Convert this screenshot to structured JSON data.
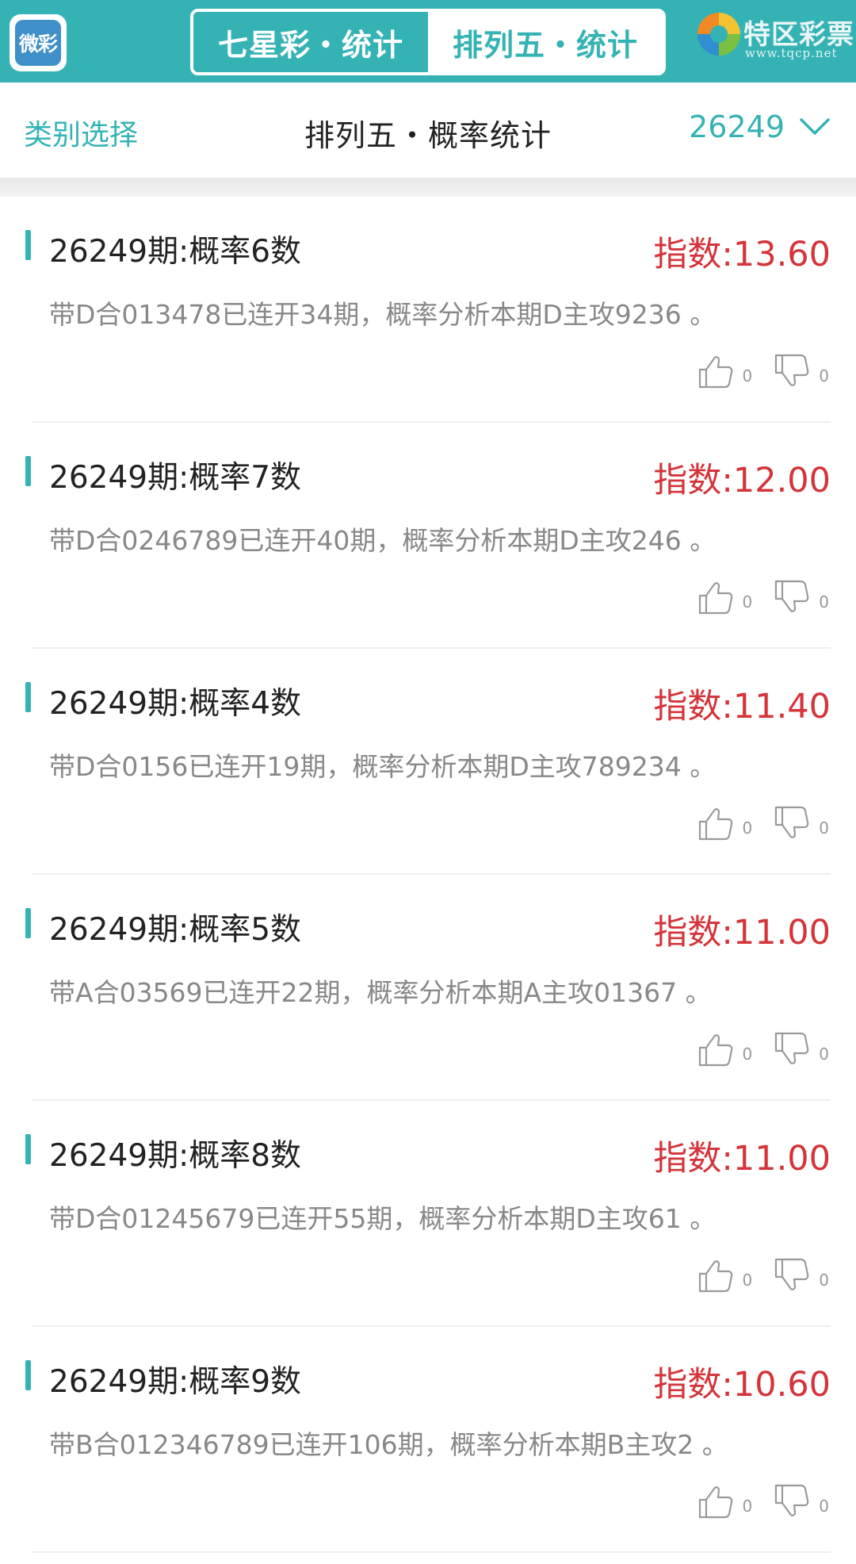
{
  "header": {
    "app_logo_text": "微彩",
    "tabs": [
      {
        "label": "七星彩・统计",
        "active": false
      },
      {
        "label": "排列五・统计",
        "active": true
      }
    ],
    "brand_name": "特区彩票网",
    "brand_url": "www.tqcp.net"
  },
  "subheader": {
    "category_label": "类别选择",
    "title": "排列五・概率统计",
    "period": "26249"
  },
  "colors": {
    "accent": "#35b3b4",
    "index_red": "#d4343a",
    "muted_text": "#888888"
  },
  "icons": {
    "like": "thumbs-up-icon",
    "dislike": "thumbs-down-icon",
    "dropdown": "chevron-down-icon"
  },
  "items": [
    {
      "title": "26249期:概率6数",
      "index": "指数:13.60",
      "desc": "带D合013478已连开34期，概率分析本期D主攻9236 。",
      "likes": "0",
      "dislikes": "0"
    },
    {
      "title": "26249期:概率7数",
      "index": "指数:12.00",
      "desc": "带D合0246789已连开40期，概率分析本期D主攻246 。",
      "likes": "0",
      "dislikes": "0"
    },
    {
      "title": "26249期:概率4数",
      "index": "指数:11.40",
      "desc": "带D合0156已连开19期，概率分析本期D主攻789234 。",
      "likes": "0",
      "dislikes": "0"
    },
    {
      "title": "26249期:概率5数",
      "index": "指数:11.00",
      "desc": "带A合03569已连开22期，概率分析本期A主攻01367 。",
      "likes": "0",
      "dislikes": "0"
    },
    {
      "title": "26249期:概率8数",
      "index": "指数:11.00",
      "desc": "带D合01245679已连开55期，概率分析本期D主攻61 。",
      "likes": "0",
      "dislikes": "0"
    },
    {
      "title": "26249期:概率9数",
      "index": "指数:10.60",
      "desc": "带B合012346789已连开106期，概率分析本期B主攻2 。",
      "likes": "0",
      "dislikes": "0"
    }
  ]
}
